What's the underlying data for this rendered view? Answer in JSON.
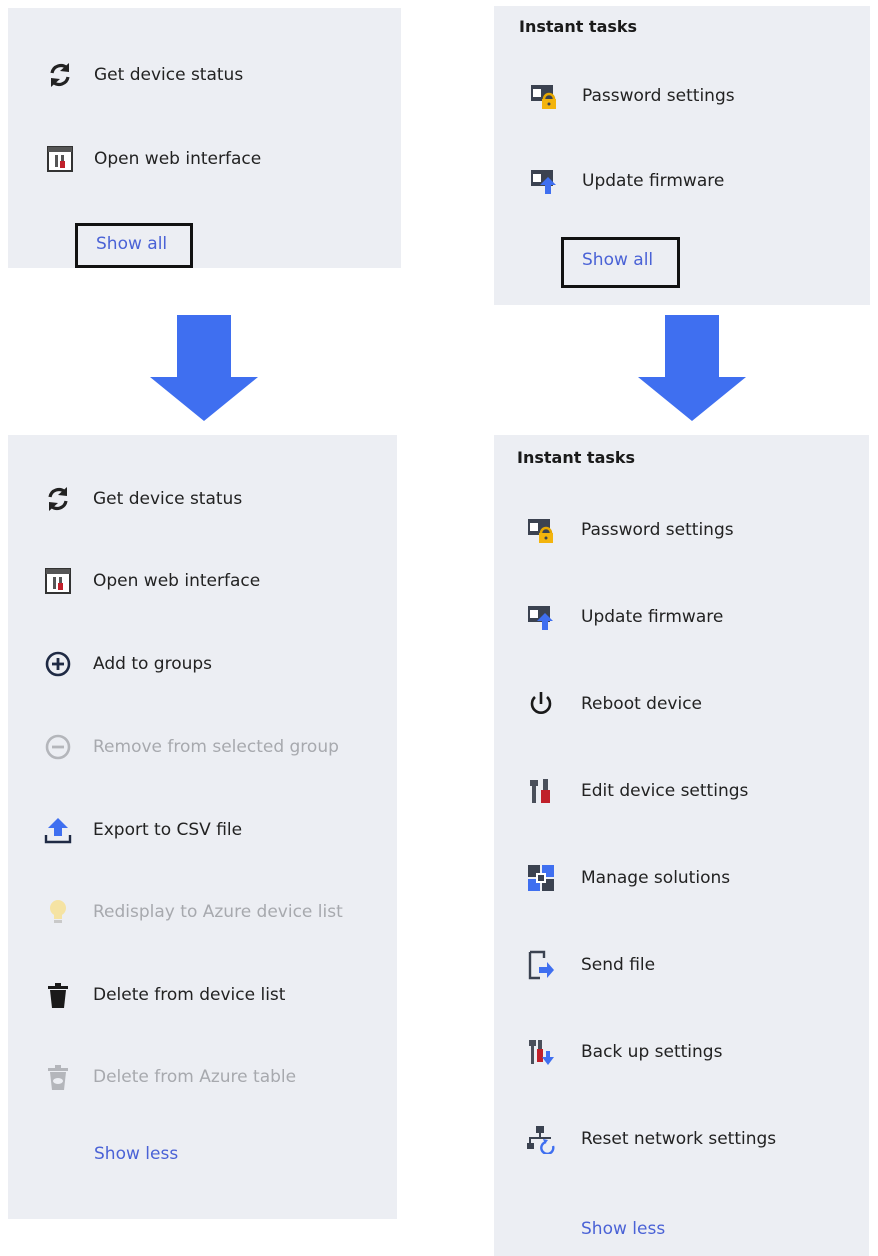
{
  "top_left": {
    "items": [
      {
        "label": "Get device status",
        "icon": "refresh-icon"
      },
      {
        "label": "Open web interface",
        "icon": "web-interface-icon"
      }
    ],
    "show_all": "Show all"
  },
  "top_right": {
    "heading": "Instant tasks",
    "items": [
      {
        "label": "Password settings",
        "icon": "password-settings-icon"
      },
      {
        "label": "Update firmware",
        "icon": "update-firmware-icon"
      }
    ],
    "show_all": "Show all"
  },
  "bottom_left": {
    "items": [
      {
        "label": "Get device status",
        "icon": "refresh-icon",
        "enabled": true
      },
      {
        "label": "Open web interface",
        "icon": "web-interface-icon",
        "enabled": true
      },
      {
        "label": "Add to groups",
        "icon": "plus-circle-icon",
        "enabled": true
      },
      {
        "label": "Remove from selected group",
        "icon": "minus-circle-icon",
        "enabled": false
      },
      {
        "label": "Export to CSV file",
        "icon": "export-upload-icon",
        "enabled": true
      },
      {
        "label": "Redisplay to Azure device list",
        "icon": "lightbulb-icon",
        "enabled": false
      },
      {
        "label": "Delete from device list",
        "icon": "trash-icon",
        "enabled": true
      },
      {
        "label": "Delete from Azure table",
        "icon": "cloud-trash-icon",
        "enabled": false
      }
    ],
    "show_less": "Show less"
  },
  "bottom_right": {
    "heading": "Instant tasks",
    "items": [
      {
        "label": "Password settings",
        "icon": "password-settings-icon"
      },
      {
        "label": "Update firmware",
        "icon": "update-firmware-icon"
      },
      {
        "label": "Reboot device",
        "icon": "power-icon"
      },
      {
        "label": "Edit device settings",
        "icon": "tools-icon"
      },
      {
        "label": "Manage solutions",
        "icon": "solutions-icon"
      },
      {
        "label": "Send file",
        "icon": "send-file-icon"
      },
      {
        "label": "Back up settings",
        "icon": "backup-settings-icon"
      },
      {
        "label": "Reset network settings",
        "icon": "reset-network-icon"
      }
    ],
    "show_less": "Show less"
  },
  "colors": {
    "panel_bg": "#eceef3",
    "link": "#4a62d6",
    "arrow": "#3f6ff0",
    "disabled": "#a7a9ae"
  }
}
